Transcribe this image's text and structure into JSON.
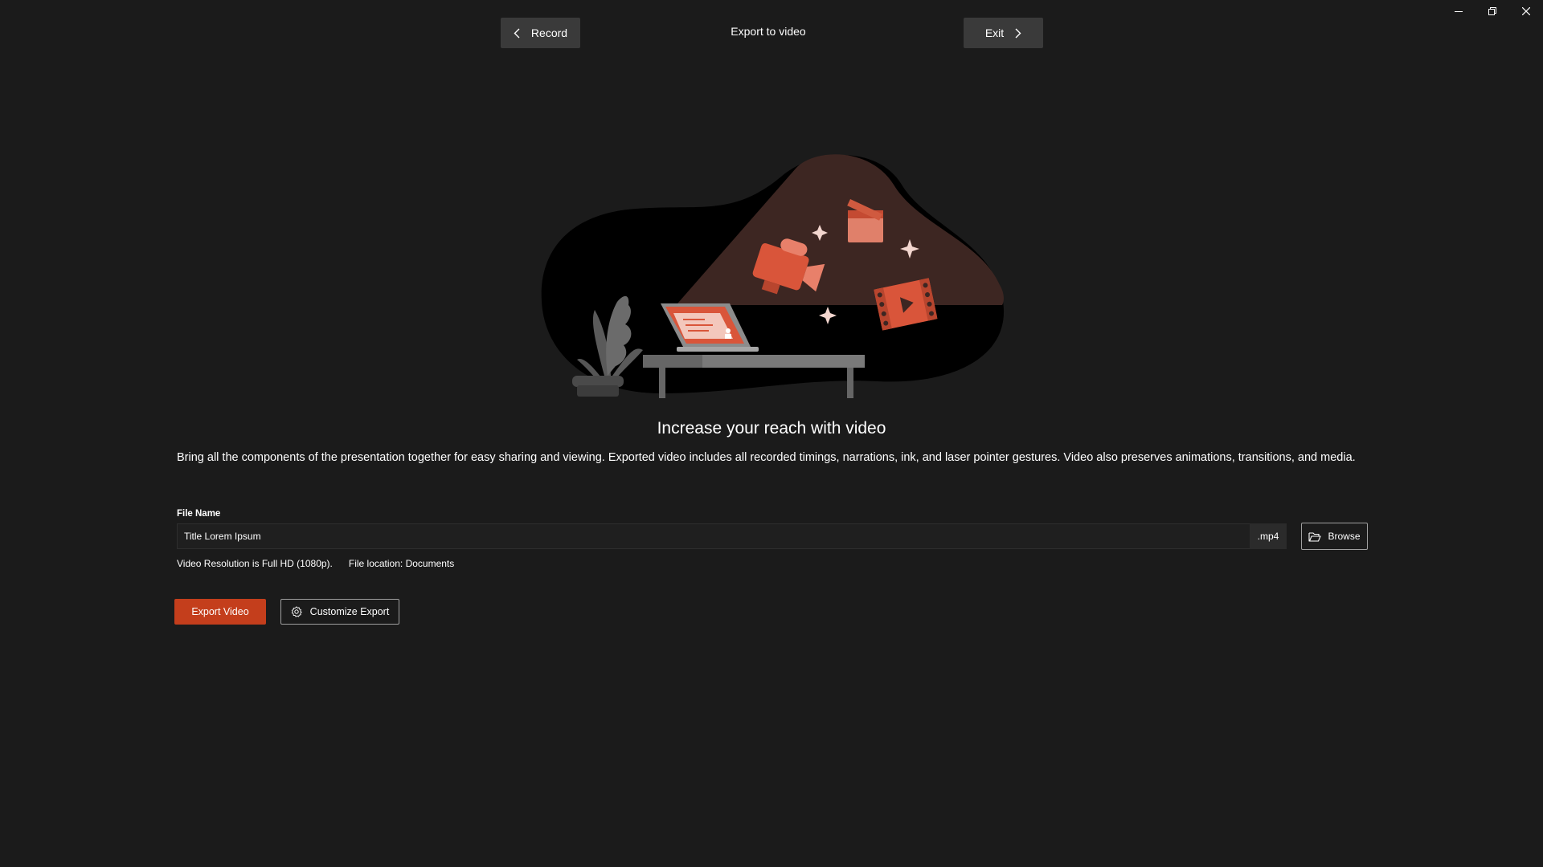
{
  "window": {
    "minimize_icon": "minimize-icon",
    "restore_icon": "restore-icon",
    "close_icon": "close-icon"
  },
  "header": {
    "back_label": "Record",
    "title": "Export to video",
    "exit_label": "Exit"
  },
  "main": {
    "heading": "Increase your reach with video",
    "description": "Bring all the components of the presentation together for easy sharing and viewing. Exported video includes all recorded timings, narrations, ink, and laser pointer gestures. Video also preserves animations, transitions, and media."
  },
  "form": {
    "file_name_label": "File Name",
    "file_name_value": "Title Lorem Ipsum",
    "extension": ".mp4",
    "browse_label": "Browse",
    "resolution_text": "Video Resolution is Full HD (1080p).",
    "location_text": "File location: Documents"
  },
  "actions": {
    "export_label": "Export Video",
    "customize_label": "Customize Export"
  },
  "colors": {
    "background": "#1b1b1b",
    "accent": "#c43e1c",
    "button_gray": "#3a3a3a"
  }
}
